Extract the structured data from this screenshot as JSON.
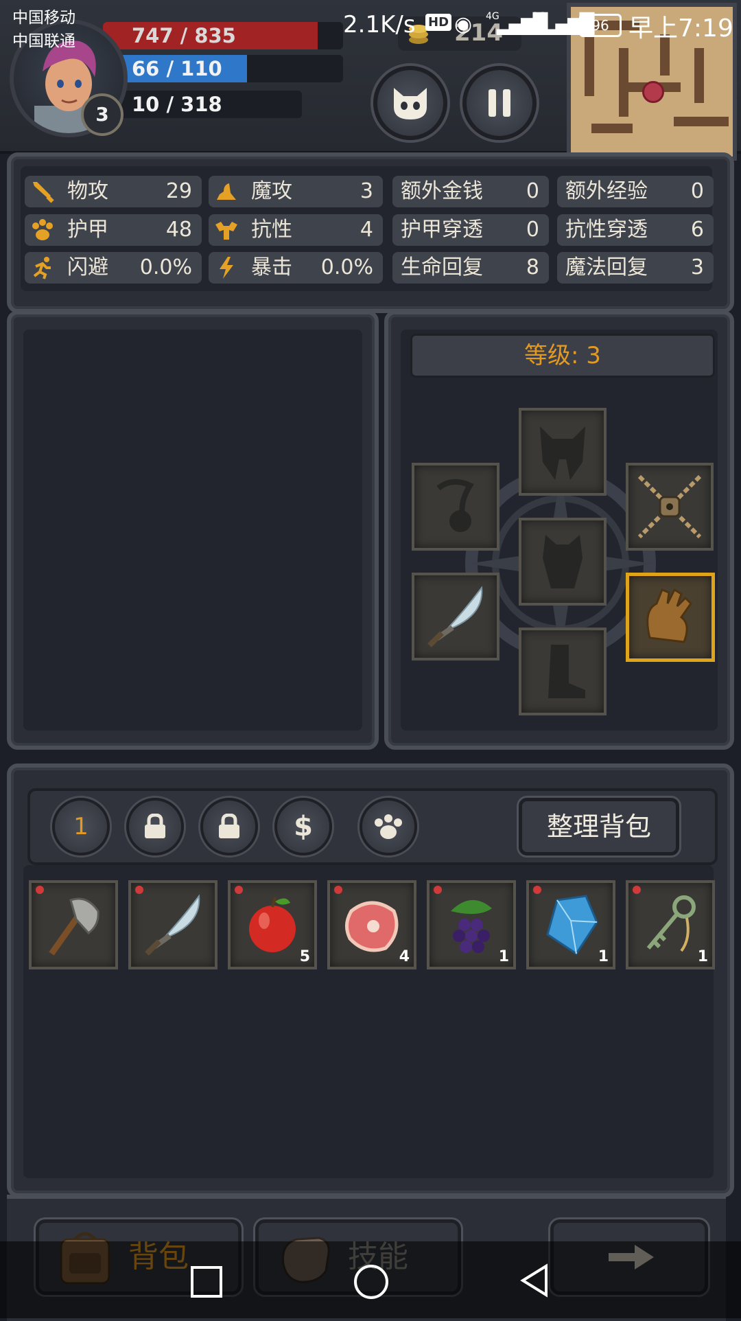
{
  "status_bar": {
    "carrier_1": "中国移动",
    "carrier_2": "中国联通",
    "net_speed": "2.1K/s",
    "hd": "HD",
    "signal_1": "4G",
    "signal_2": "2G",
    "battery": "96",
    "time": "早上7:19"
  },
  "hud": {
    "hp": "747 / 835",
    "hp_fraction": 0.895,
    "mp": "66 / 110",
    "mp_fraction": 0.6,
    "xp": "10 / 318",
    "xp_fraction": 0.031,
    "player_level": "3",
    "gold": "214",
    "colors": {
      "hp": "#a12323",
      "mp": "#2f77c8",
      "xp": "#1b1e24"
    }
  },
  "stats": [
    {
      "label": "物攻",
      "value": "29",
      "icon": "sword-icon"
    },
    {
      "label": "魔攻",
      "value": "3",
      "icon": "wizard-hat-icon"
    },
    {
      "label": "额外金钱",
      "value": "0"
    },
    {
      "label": "额外经验",
      "value": "0"
    },
    {
      "label": "护甲",
      "value": "48",
      "icon": "paw-icon"
    },
    {
      "label": "抗性",
      "value": "4",
      "icon": "muscle-icon"
    },
    {
      "label": "护甲穿透",
      "value": "0"
    },
    {
      "label": "抗性穿透",
      "value": "6"
    },
    {
      "label": "闪避",
      "value": "0.0%",
      "icon": "running-man-icon"
    },
    {
      "label": "暴击",
      "value": "0.0%",
      "icon": "lightning-icon"
    },
    {
      "label": "生命回复",
      "value": "8"
    },
    {
      "label": "魔法回复",
      "value": "3"
    }
  ],
  "equipment": {
    "level_label": "等级: 3",
    "slots": [
      "helmet-slot",
      "amulet-slot",
      "chain-lock-slot",
      "armor-slot",
      "dagger-slot",
      "gloves-slot",
      "boots-slot"
    ]
  },
  "toolbar": {
    "page_number": "1",
    "sort_label": "整理背包"
  },
  "inventory": [
    {
      "name": "axe",
      "count": ""
    },
    {
      "name": "dagger",
      "count": ""
    },
    {
      "name": "apple",
      "count": "5"
    },
    {
      "name": "meat",
      "count": "4"
    },
    {
      "name": "grapes",
      "count": "1"
    },
    {
      "name": "crystal",
      "count": "1"
    },
    {
      "name": "key",
      "count": "1"
    }
  ],
  "tabs": {
    "bag": "背包",
    "skills": "技能"
  }
}
